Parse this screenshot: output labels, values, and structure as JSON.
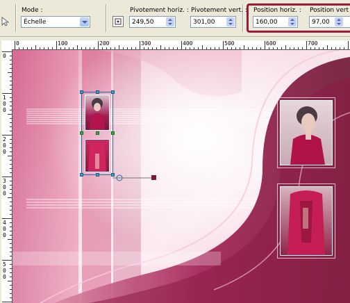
{
  "toolbar": {
    "mode": {
      "label": "Mode :",
      "value": "Échelle"
    },
    "pivot_h": {
      "label": "Pivotement horiz. :",
      "value": "249,50"
    },
    "pivot_v": {
      "label": "Pivotement vert. :",
      "value": "301,00"
    },
    "pos_h": {
      "label": "Position horiz. :",
      "value": "160,00"
    },
    "pos_v": {
      "label": "Position vert",
      "value": "97,00"
    }
  },
  "ruler": {
    "top_labels": [
      "0",
      "100",
      "200",
      "300",
      "400",
      "500",
      "600",
      "700"
    ],
    "left_labels": [
      "0",
      "100",
      "200",
      "300",
      "400",
      "500"
    ]
  },
  "colors": {
    "highlight": "#9b1a3a",
    "accent_pink": "#c2185b",
    "dark_magenta": "#8a1c45"
  }
}
